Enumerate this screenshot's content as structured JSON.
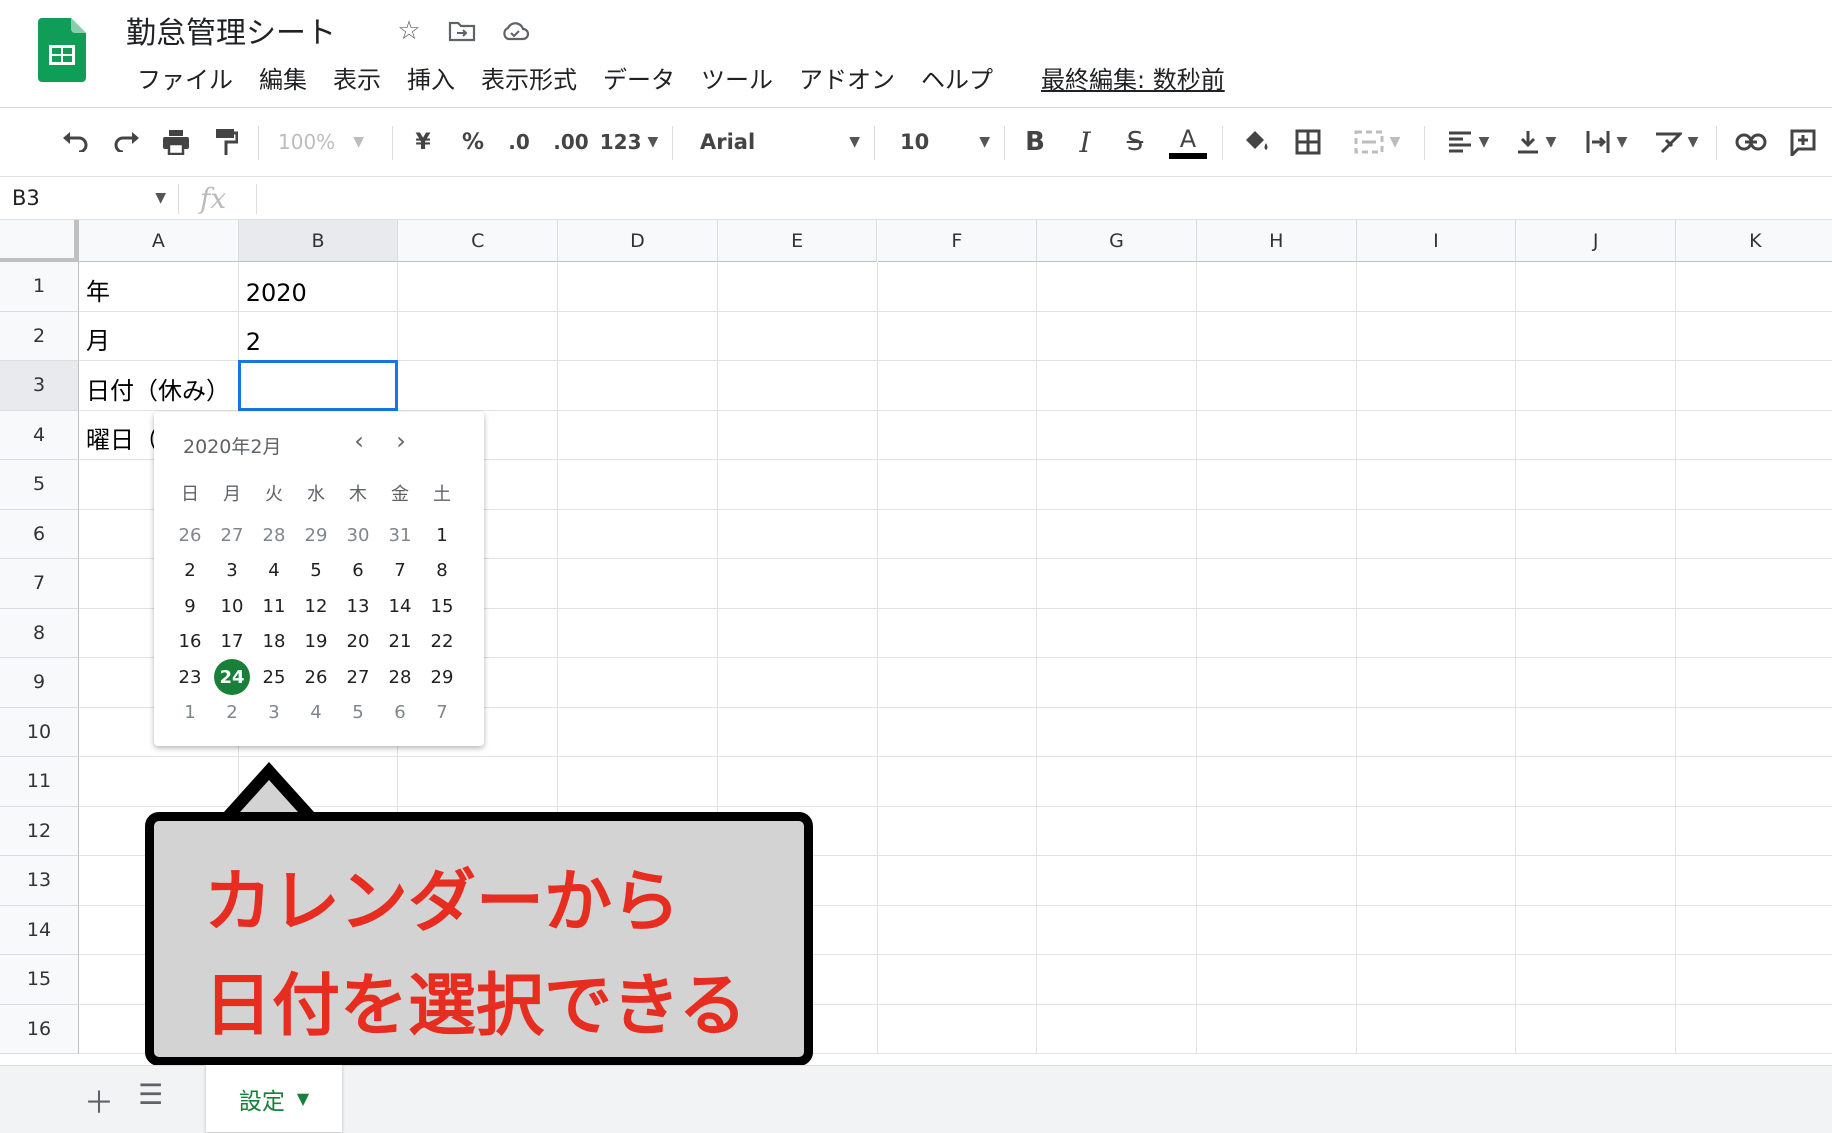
{
  "app": {
    "title": "勤怠管理シート",
    "menu": [
      "ファイル",
      "編集",
      "表示",
      "挿入",
      "表示形式",
      "データ",
      "ツール",
      "アドオン",
      "ヘルプ"
    ],
    "last_edit": "最終編集: 数秒前",
    "icons": [
      "star-icon",
      "move-to-folder-icon",
      "cloud-status-icon"
    ]
  },
  "toolbar": {
    "zoom": "100%",
    "currency": "¥",
    "percent": "%",
    "decrease_decimal": ".0",
    "increase_decimal": ".00",
    "number_format": "123",
    "font": "Arial",
    "font_size": "10",
    "bold": "B",
    "italic": "I",
    "strikethrough": "S",
    "text_color": "A",
    "text_color_value": "#000000"
  },
  "formula_bar": {
    "name_box": "B3",
    "fx": "fx"
  },
  "grid": {
    "columns": [
      "A",
      "B",
      "C",
      "D",
      "E",
      "F",
      "G",
      "H",
      "I",
      "J",
      "K"
    ],
    "selected_column": "B",
    "rows": [
      "1",
      "2",
      "3",
      "4",
      "5",
      "6",
      "7",
      "8",
      "9",
      "10",
      "11",
      "12",
      "13",
      "14",
      "15",
      "16"
    ],
    "selected_row": "3",
    "cells": {
      "A1": "年",
      "B1": "2020",
      "A2": "月",
      "B2": "2",
      "A3": "日付（休み）",
      "A4": "曜日（"
    },
    "active_cell": "B3"
  },
  "date_picker": {
    "month_label": "2020年2月",
    "weekdays": [
      "日",
      "月",
      "火",
      "水",
      "木",
      "金",
      "土"
    ],
    "weeks": [
      [
        "26",
        "27",
        "28",
        "29",
        "30",
        "31",
        "1"
      ],
      [
        "2",
        "3",
        "4",
        "5",
        "6",
        "7",
        "8"
      ],
      [
        "9",
        "10",
        "11",
        "12",
        "13",
        "14",
        "15"
      ],
      [
        "16",
        "17",
        "18",
        "19",
        "20",
        "21",
        "22"
      ],
      [
        "23",
        "24",
        "25",
        "26",
        "27",
        "28",
        "29"
      ],
      [
        "1",
        "2",
        "3",
        "4",
        "5",
        "6",
        "7"
      ]
    ],
    "today": "24",
    "today_color": "#188038"
  },
  "callout": {
    "line1": "カレンダーから",
    "line2": "日付を選択できる",
    "text_color": "#e62d20"
  },
  "sheets": {
    "tabs": [
      "設定"
    ],
    "active_color": "#188038"
  }
}
